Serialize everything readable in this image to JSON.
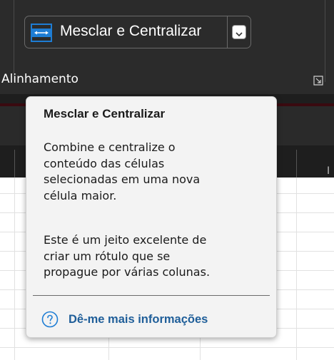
{
  "ribbon": {
    "merge_button_label": "Mesclar e Centralizar",
    "group_label": "Alinhamento",
    "merge_icon": "merge-center-icon",
    "dropdown_icon": "chevron-down-icon",
    "launcher_icon": "dialog-launcher-icon"
  },
  "sheet": {
    "partial_column_header": "I"
  },
  "tooltip": {
    "title": "Mesclar e Centralizar",
    "paragraph1": "Combine e centralize o\nconteúdo das células\nselecionadas em uma nova\ncélula maior.",
    "paragraph2": "Este é um jeito excelente de\ncriar um rótulo que se\npropague por várias colunas.",
    "help_link": "Dê-me mais informações",
    "help_icon": "question-circle-icon"
  },
  "colors": {
    "ribbon_bg": "#2b2b2b",
    "tooltip_bg": "#f3f3f3",
    "link_color": "#1f5e99",
    "merge_icon_accent": "#1e7dd4"
  }
}
